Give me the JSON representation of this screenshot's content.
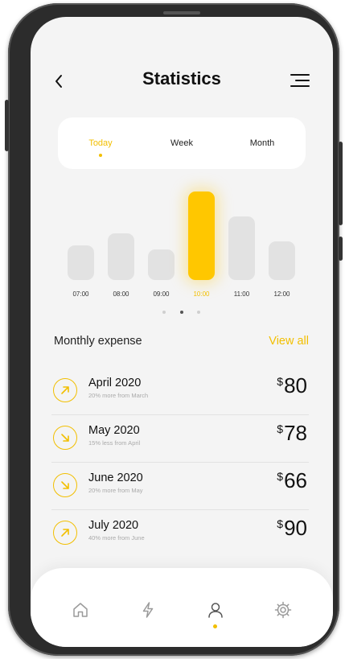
{
  "header": {
    "title": "Statistics",
    "back_icon": "chevron-left-icon",
    "menu_icon": "menu-icon"
  },
  "tabs": [
    {
      "label": "Today",
      "active": true
    },
    {
      "label": "Week",
      "active": false
    },
    {
      "label": "Month",
      "active": false
    }
  ],
  "chart_data": {
    "type": "bar",
    "categories": [
      "07:00",
      "08:00",
      "09:00",
      "10:00",
      "11:00",
      "12:00"
    ],
    "values": [
      3.2,
      4.3,
      2.8,
      8.2,
      5.9,
      3.6
    ],
    "highlight": "10:00",
    "grid": false
  },
  "pager": {
    "count": 3,
    "active": 1
  },
  "expenses": {
    "title": "Monthly expense",
    "view_all": "View all",
    "items": [
      {
        "month": "April 2020",
        "note": "20% more from March",
        "currency": "$",
        "amount": "80",
        "direction": "up"
      },
      {
        "month": "May 2020",
        "note": "15% less from April",
        "currency": "$",
        "amount": "78",
        "direction": "down"
      },
      {
        "month": "June 2020",
        "note": "20% more from May",
        "currency": "$",
        "amount": "66",
        "direction": "down"
      },
      {
        "month": "July 2020",
        "note": "40% more from June",
        "currency": "$",
        "amount": "90",
        "direction": "up"
      }
    ]
  },
  "nav": {
    "items": [
      {
        "icon": "home-icon",
        "active": false
      },
      {
        "icon": "lightning-icon",
        "active": false
      },
      {
        "icon": "user-icon",
        "active": true
      },
      {
        "icon": "settings-icon",
        "active": false
      }
    ]
  },
  "colors": {
    "accent": "#f2bf00",
    "bar_inactive": "#e2e2e2",
    "background": "#f4f4f4"
  }
}
